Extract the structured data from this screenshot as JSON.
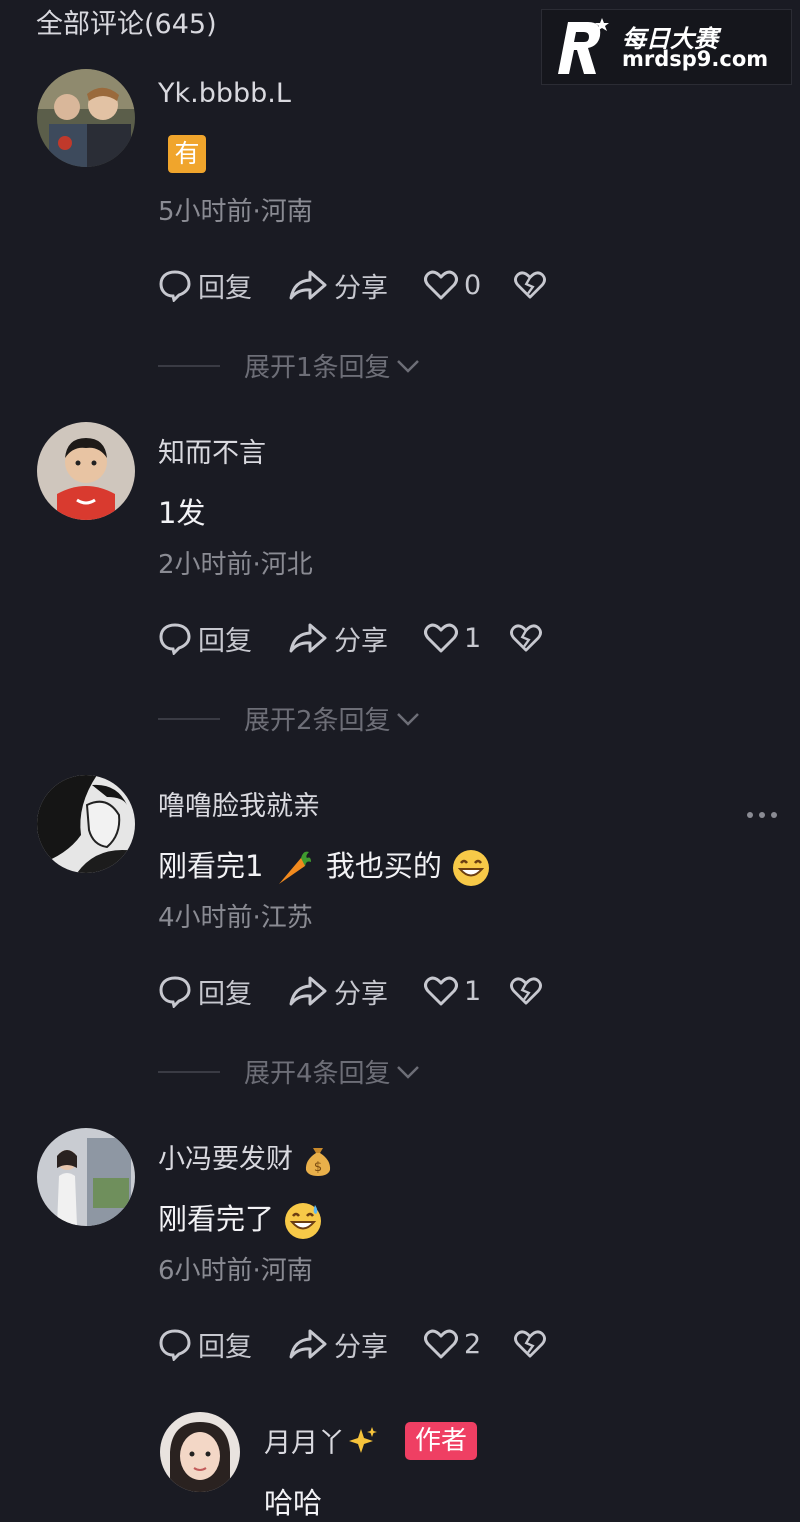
{
  "header": {
    "title": "全部评论(645)"
  },
  "watermark": {
    "cn": "每日大赛",
    "url": "mrdsp9.com"
  },
  "actions": {
    "reply": "回复",
    "share": "分享"
  },
  "comments": [
    {
      "username": "Yk.bbbb.L",
      "text": "有",
      "time_location": "5小时前·河南",
      "likes": "0",
      "expand": "展开1条回复"
    },
    {
      "username": "知而不言",
      "text": "1发",
      "time_location": "2小时前·河北",
      "likes": "1",
      "expand": "展开2条回复"
    },
    {
      "username": "噜噜脸我就亲",
      "text_part1": "刚看完1",
      "text_part2": "我也买的",
      "time_location": "4小时前·江苏",
      "likes": "1",
      "expand": "展开4条回复"
    },
    {
      "username": "小冯要发财",
      "text": "刚看完了",
      "time_location": "6小时前·河南",
      "likes": "2"
    }
  ],
  "reply": {
    "username": "月月丫",
    "badge": "作者",
    "text": "哈哈"
  },
  "icons": [
    "reply-bubble-icon",
    "share-arrow-icon",
    "heart-icon",
    "dislike-heart-icon",
    "more-dots-icon",
    "carrot-emoji",
    "grin-emoji",
    "money-bag-emoji",
    "sweat-smile-emoji",
    "sparkles-emoji",
    "chevron-down-icon"
  ]
}
